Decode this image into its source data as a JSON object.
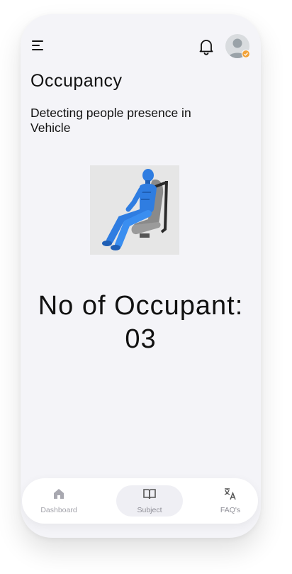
{
  "header": {
    "menu_icon": "hamburger-menu-icon",
    "notification_icon": "bell-icon",
    "avatar_icon": "user-avatar",
    "badge_color": "#f2a33a"
  },
  "page": {
    "title": "Occupancy",
    "subtitle": "Detecting people presence in Vehicle"
  },
  "illustration": {
    "subject": "crash-test-dummy-seated-icon",
    "dummy_color": "#2f7de1"
  },
  "occupancy": {
    "label": "No of Occupant:",
    "count": "03"
  },
  "bottom_nav": {
    "items": [
      {
        "label": "Dashboard",
        "icon": "home-icon",
        "active": false
      },
      {
        "label": "Subject",
        "icon": "book-icon",
        "active": true
      },
      {
        "label": "FAQ's",
        "icon": "translate-icon",
        "active": false
      }
    ]
  }
}
